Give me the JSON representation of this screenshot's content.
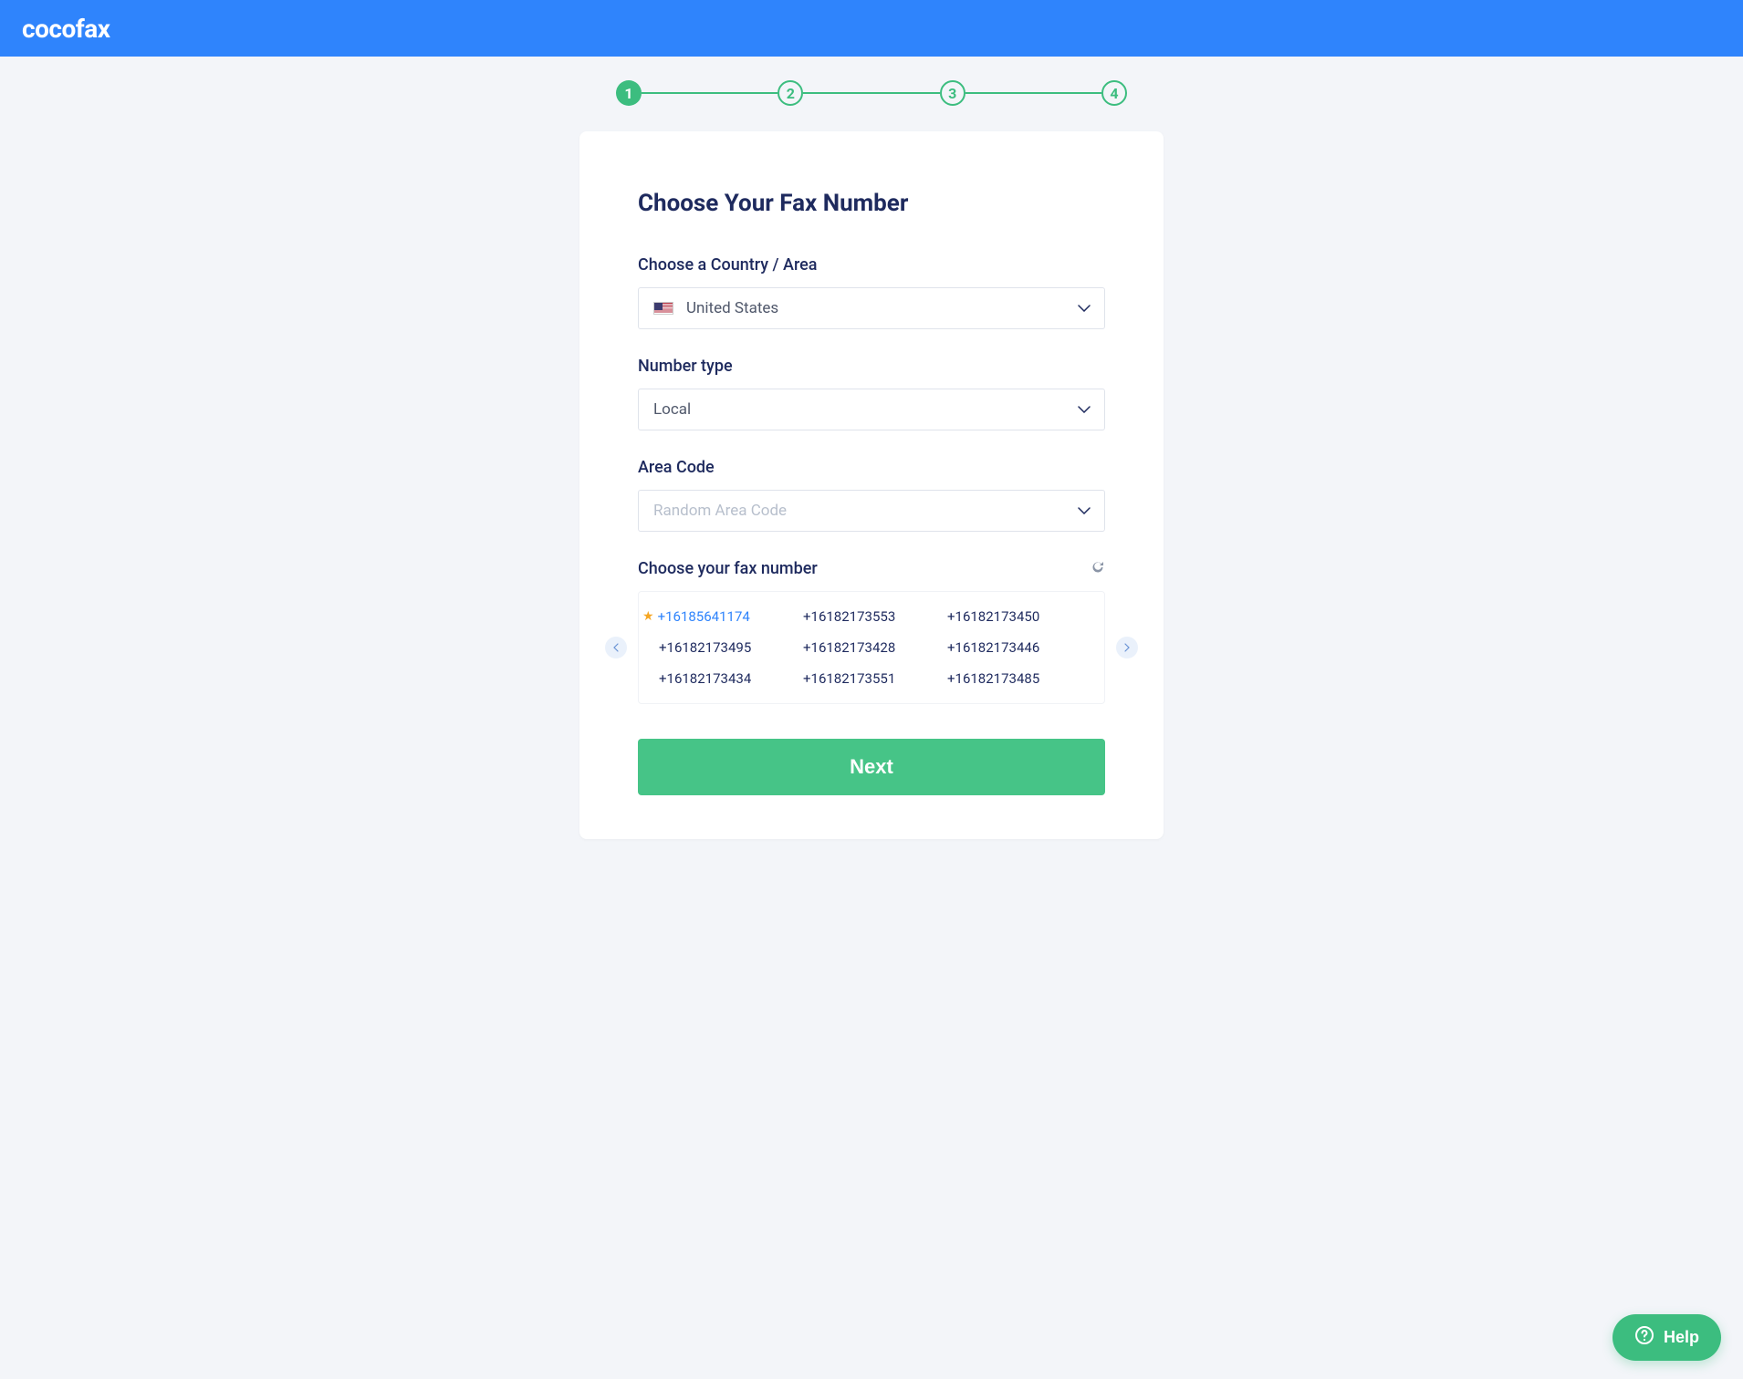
{
  "brand": "cocofax",
  "stepper": {
    "current": 1,
    "steps": [
      "1",
      "2",
      "3",
      "4"
    ]
  },
  "form": {
    "title": "Choose Your Fax Number",
    "country": {
      "label": "Choose a Country / Area",
      "value": "United States"
    },
    "numberType": {
      "label": "Number type",
      "value": "Local"
    },
    "areaCode": {
      "label": "Area Code",
      "placeholder": "Random Area Code"
    },
    "numbers": {
      "label": "Choose your fax number",
      "selected": "+16185641174",
      "list": [
        "+16185641174",
        "+16182173553",
        "+16182173450",
        "+16182173495",
        "+16182173428",
        "+16182173446",
        "+16182173434",
        "+16182173551",
        "+16182173485"
      ]
    },
    "nextLabel": "Next"
  },
  "help": {
    "label": "Help"
  }
}
